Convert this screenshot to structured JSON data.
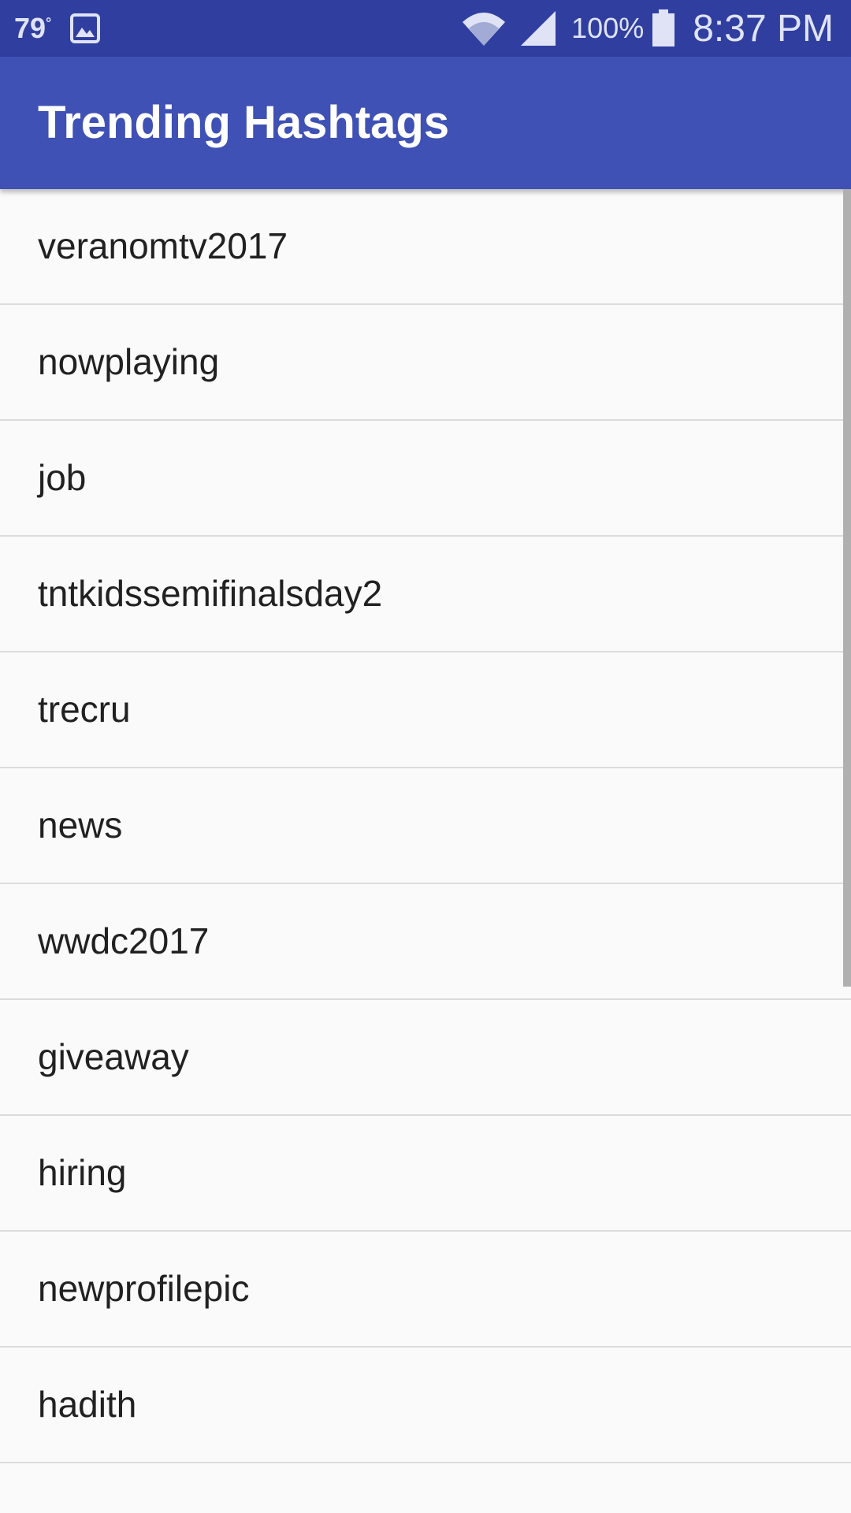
{
  "status_bar": {
    "temperature": "79",
    "degree": "°",
    "battery_percent": "100%",
    "time": "8:37 PM",
    "icons": [
      "gallery-icon",
      "wifi-icon",
      "signal-icon",
      "battery-icon"
    ]
  },
  "app_bar": {
    "title": "Trending Hashtags",
    "color": "#3f51b5",
    "status_color": "#303f9f"
  },
  "list": {
    "items": [
      {
        "label": "veranomtv2017"
      },
      {
        "label": "nowplaying"
      },
      {
        "label": "job"
      },
      {
        "label": "tntkidssemifinalsday2"
      },
      {
        "label": "trecru"
      },
      {
        "label": "news"
      },
      {
        "label": "wwdc2017"
      },
      {
        "label": "giveaway"
      },
      {
        "label": "hiring"
      },
      {
        "label": "newprofilepic"
      },
      {
        "label": "hadith"
      }
    ]
  }
}
